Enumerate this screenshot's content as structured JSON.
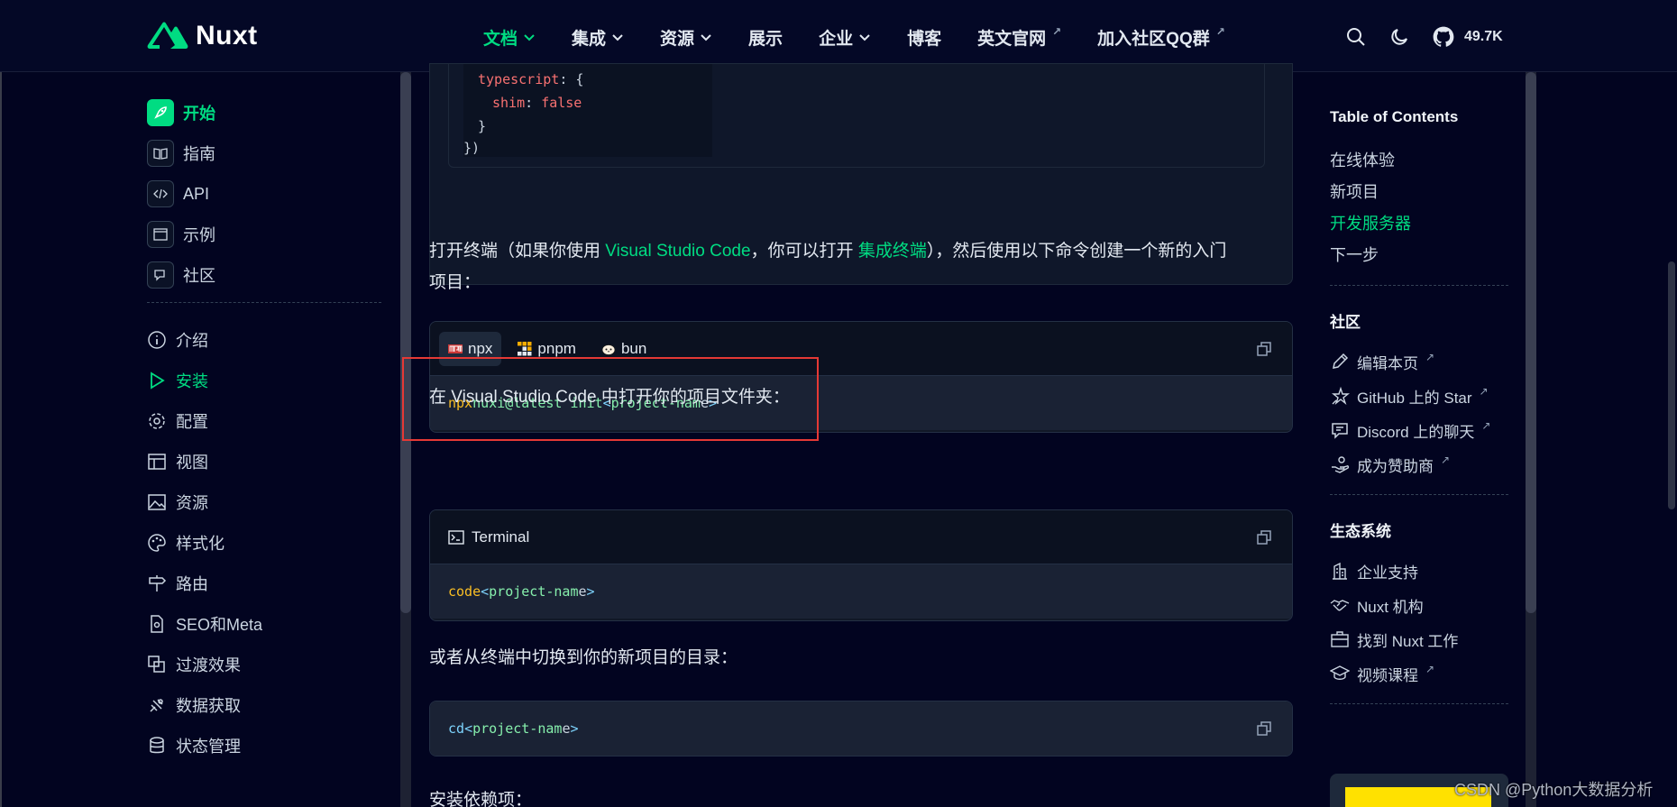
{
  "header": {
    "logo_text": "Nuxt",
    "nav": [
      {
        "label": "文档",
        "dropdown": true,
        "active": true
      },
      {
        "label": "集成",
        "dropdown": true
      },
      {
        "label": "资源",
        "dropdown": true
      },
      {
        "label": "展示",
        "dropdown": false
      },
      {
        "label": "企业",
        "dropdown": true
      },
      {
        "label": "博客",
        "dropdown": false
      },
      {
        "label": "英文官网",
        "external": true
      },
      {
        "label": "加入社区QQ群",
        "external": true
      }
    ],
    "stars": "49.7K",
    "ext_mark": "↗"
  },
  "sidebar": {
    "top": [
      {
        "label": "开始",
        "icon": "rocket-icon",
        "active": true
      },
      {
        "label": "指南",
        "icon": "book-icon"
      },
      {
        "label": "API",
        "icon": "code-icon"
      },
      {
        "label": "示例",
        "icon": "browser-icon"
      },
      {
        "label": "社区",
        "icon": "chat-icon"
      }
    ],
    "sub": [
      {
        "label": "介绍",
        "icon": "info-icon"
      },
      {
        "label": "安装",
        "icon": "play-icon",
        "active": true
      },
      {
        "label": "配置",
        "icon": "gear-icon"
      },
      {
        "label": "视图",
        "icon": "layout-icon"
      },
      {
        "label": "资源",
        "icon": "image-icon"
      },
      {
        "label": "样式化",
        "icon": "palette-icon"
      },
      {
        "label": "路由",
        "icon": "signpost-icon"
      },
      {
        "label": "SEO和Meta",
        "icon": "file-search-icon"
      },
      {
        "label": "过渡效果",
        "icon": "transition-icon"
      },
      {
        "label": "数据获取",
        "icon": "satellite-icon"
      },
      {
        "label": "状态管理",
        "icon": "database-icon"
      }
    ]
  },
  "content": {
    "code_top": {
      "line1_key": "typescript",
      "line1_rest": ": {",
      "line2_key": "shim",
      "line2_colon": ": ",
      "line2_val": "false",
      "line3": "}",
      "line4": "})"
    },
    "para1": {
      "a": "打开终端（如果你使用 ",
      "link1": "Visual Studio Code",
      "b": "，你可以打开 ",
      "link2": "集成终端",
      "c": "），然后使用以下命令创建一个新的入门",
      "d": "项目："
    },
    "tabs": [
      {
        "label": "npx",
        "active": true
      },
      {
        "label": "pnpm"
      },
      {
        "label": "bun"
      }
    ],
    "cmd1": {
      "a": "npx",
      "b": " nuxi@latest init ",
      "c": "<",
      "d": "project-nam",
      "e": "e",
      "f": ">"
    },
    "para2": "在 Visual Studio Code 中打开你的项目文件夹：",
    "terminal_label": "Terminal",
    "cmd2": {
      "a": "code",
      "b": " ",
      "c": "<",
      "d": "project-nam",
      "e": "e",
      "f": ">"
    },
    "para3": "或者从终端中切换到你的新项目的目录：",
    "cmd3": {
      "a": "cd",
      "b": " ",
      "c": "<",
      "d": "project-nam",
      "e": "e",
      "f": ">"
    },
    "para4": "安装依赖项："
  },
  "toc": {
    "title": "Table of Contents",
    "items": [
      {
        "label": "在线体验"
      },
      {
        "label": "新项目"
      },
      {
        "label": "开发服务器",
        "active": true
      },
      {
        "label": "下一步"
      }
    ],
    "community_title": "社区",
    "community": [
      {
        "label": "编辑本页",
        "icon": "pencil-icon"
      },
      {
        "label": "GitHub 上的 Star",
        "icon": "star-icon"
      },
      {
        "label": "Discord 上的聊天",
        "icon": "message-icon"
      },
      {
        "label": "成为赞助商",
        "icon": "hands-icon"
      }
    ],
    "eco_title": "生态系统",
    "eco": [
      {
        "label": "企业支持",
        "icon": "building-icon"
      },
      {
        "label": "Nuxt 机构",
        "icon": "handshake-icon"
      },
      {
        "label": "找到 Nuxt 工作",
        "icon": "briefcase-icon"
      },
      {
        "label": "视频课程",
        "icon": "graduation-icon"
      }
    ]
  },
  "watermark": "CSDN @Python大数据分析",
  "colors": {
    "accent": "#00dc82",
    "background": "#020420",
    "highlight": "#e53935"
  }
}
